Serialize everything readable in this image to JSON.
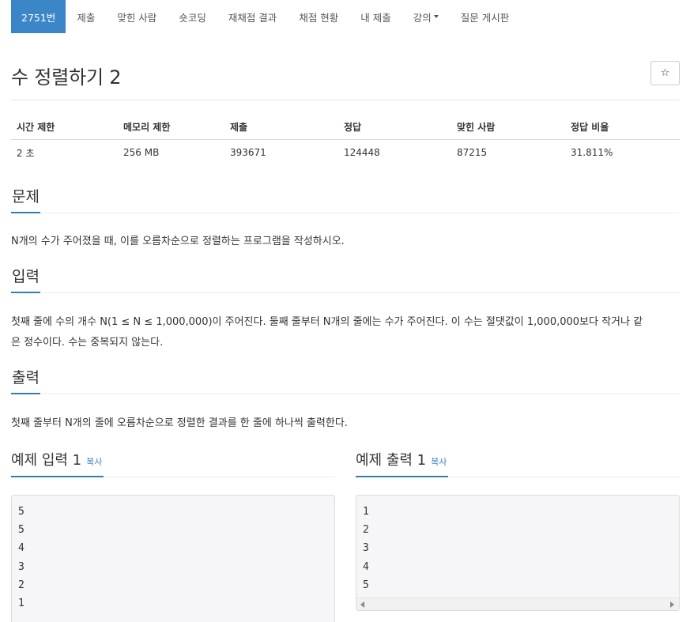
{
  "nav": {
    "tabs": [
      {
        "label": "2751번"
      },
      {
        "label": "제출"
      },
      {
        "label": "맞힌 사람"
      },
      {
        "label": "숏코딩"
      },
      {
        "label": "재채점 결과"
      },
      {
        "label": "채점 현황"
      },
      {
        "label": "내 제출"
      },
      {
        "label": "강의"
      },
      {
        "label": "질문 게시판"
      }
    ],
    "active_tab": "2751번"
  },
  "problem": {
    "title": "수 정렬하기 2",
    "star_icon": "☆"
  },
  "info": {
    "headers": [
      "시간 제한",
      "메모리 제한",
      "제출",
      "정답",
      "맞힌 사람",
      "정답 비율"
    ],
    "values": [
      "2 초",
      "256 MB",
      "393671",
      "124448",
      "87215",
      "31.811%"
    ]
  },
  "sections": {
    "problem_heading": "문제",
    "problem_text": "N개의 수가 주어졌을 때, 이를 오름차순으로 정렬하는 프로그램을 작성하시오.",
    "input_heading": "입력",
    "input_text_1": "첫째 줄에 수의 개수 N(1 ≤ N ≤ 1,000,000)이 주어진다. 둘째 줄부터 N개의 줄에는 수가 주어진다. 이 수는 절댓값이 1,000,000보다 작거나 같",
    "input_text_2": "은 정수이다. 수는 중복되지 않는다.",
    "output_heading": "출력",
    "output_text": "첫째 줄부터 N개의 줄에 오름차순으로 정렬한 결과를 한 줄에 하나씩 출력한다."
  },
  "samples": {
    "input_title": "예제 입력 1",
    "output_title": "예제 출력 1",
    "copy_label": "복사",
    "input_lines": [
      "5",
      "5",
      "4",
      "3",
      "2",
      "1"
    ],
    "output_lines": [
      "1",
      "2",
      "3",
      "4",
      "5"
    ]
  },
  "colors": {
    "accent": "#3b86c6",
    "underline": "#2e7fb0",
    "pre_background": "#f6f6f8"
  }
}
